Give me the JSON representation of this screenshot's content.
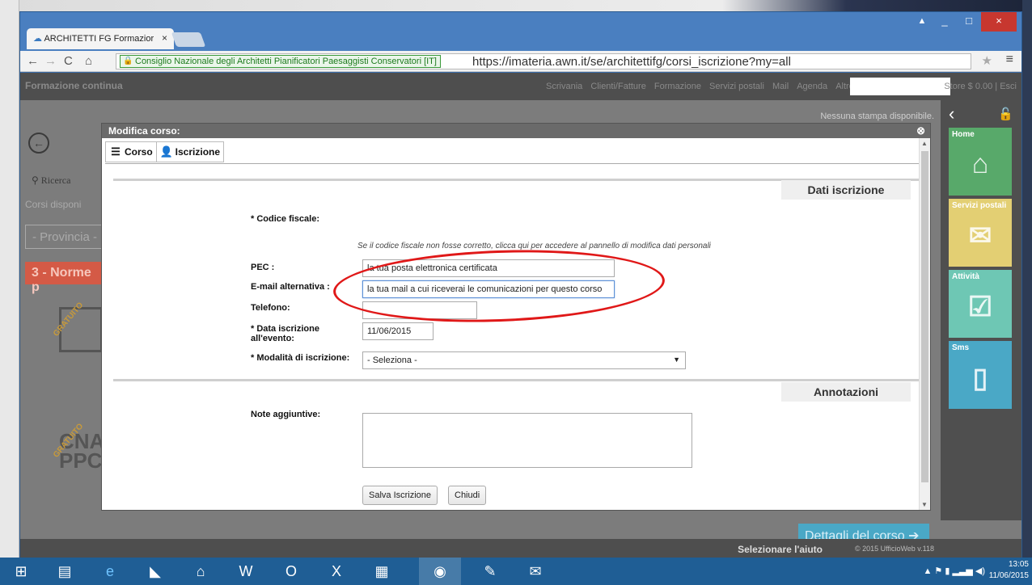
{
  "browser": {
    "tab_title": "ARCHITETTI FG Formazior",
    "tab_close": "×",
    "cert_owner": "Consiglio Nazionale degli Architetti Pianificatori Paesaggisti Conservatori [IT]",
    "url": "https://imateria.awn.it/se/architettifg/corsi_iscrizione?my=all",
    "window_buttons": [
      "_",
      "□",
      "×"
    ]
  },
  "app": {
    "logo": "Formazione continua",
    "nav": [
      "Scrivania",
      "Clienti/Fatture",
      "Formazione",
      "Servizi postali",
      "Mail",
      "Agenda",
      "Altro..."
    ],
    "store": "Store $ 0.00 | Esci",
    "no_print": "Nessuna stampa disponibile.",
    "ricerca": "Ricerca",
    "corsi_disponibili": "Corsi disponi",
    "provincia": "- Provincia -",
    "norme": "3 - Norme p",
    "gratuito": "GRATUITO",
    "thumb2_text": "CNA\nPPC",
    "dettagli": "Dettagli del corso",
    "selezionare_aiuto": "Selezionare l'aiuto",
    "copyright": "© 2015 UfficioWeb v.118"
  },
  "tiles": [
    {
      "label": "Home",
      "icon": "home-icon"
    },
    {
      "label": "Servizi postali",
      "icon": "envelope-icon"
    },
    {
      "label": "Attività",
      "icon": "tasks-icon"
    },
    {
      "label": "Sms",
      "icon": "phone-icon"
    }
  ],
  "modal": {
    "title": "Modifica corso:",
    "tabs": [
      "Corso",
      "Iscrizione"
    ],
    "section_iscrizione": "Dati iscrizione",
    "section_annotazioni": "Annotazioni",
    "codice_fiscale_label": "* Codice fiscale:",
    "hint": "Se il codice fiscale non fosse corretto, clicca qui per accedere al pannello di modifica dati personali",
    "pec_label": "PEC :",
    "pec_value": "la tua posta elettronica certificata",
    "email_label": "E-mail alternativa :",
    "email_value": "la tua mail a cui riceverai le comunicazioni per questo corso",
    "telefono_label": "Telefono:",
    "telefono_value": "",
    "data_label_1": "* Data iscrizione",
    "data_label_2": "all'evento:",
    "data_value": "11/06/2015",
    "modalita_label": "* Modalità di iscrizione:",
    "modalita_value": "- Seleziona -",
    "note_label": "Note aggiuntive:",
    "save_button": "Salva Iscrizione",
    "close_button": "Chiudi"
  },
  "taskbar": {
    "time": "13:05",
    "date": "11/06/2015"
  },
  "colors": {
    "highlight_ellipse": "#e01818",
    "tile_home": "#58a96a",
    "tile_servizi": "#e3cf73",
    "tile_attivita": "#6ec7b4",
    "tile_sms": "#4aa8c6"
  }
}
